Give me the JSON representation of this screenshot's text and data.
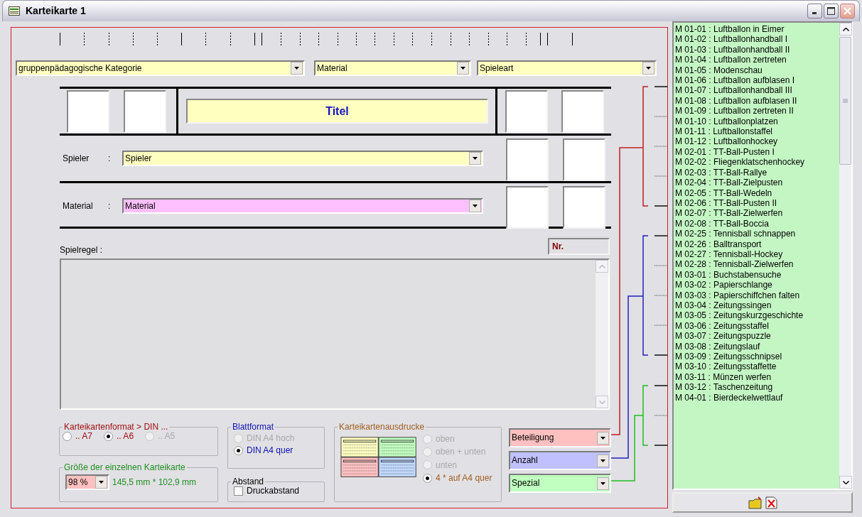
{
  "window": {
    "title": "Karteikarte 1"
  },
  "category_selects": [
    {
      "value": "gruppenpädagogische Kategorie"
    },
    {
      "value": "Material"
    },
    {
      "value": "Spieleart"
    }
  ],
  "title_field": {
    "value": "Titel"
  },
  "player_row": {
    "label": "Spieler",
    "separator": ":",
    "value": "Spieler"
  },
  "material_row": {
    "label": "Material",
    "separator": ":",
    "value": "Material"
  },
  "rules": {
    "label": "Spielregel :",
    "number_field": "Nr."
  },
  "card_format": {
    "legend": "Karteikartenformat > DIN ...",
    "options": [
      {
        "label": ".. A7",
        "selected": false,
        "disabled": false
      },
      {
        "label": ".. A6",
        "selected": true,
        "disabled": false
      },
      {
        "label": ".. A5",
        "selected": false,
        "disabled": true
      }
    ]
  },
  "card_size": {
    "legend": "Größe der einzelnen Karteikarte",
    "percent": "98 %",
    "dimensions": "145,5 mm * 102,9 mm"
  },
  "sheet_format": {
    "legend": "Blattformat",
    "options": [
      {
        "label": "DIN A4 hoch",
        "selected": false,
        "disabled": true
      },
      {
        "label": "DIN A4 quer",
        "selected": true,
        "disabled": false
      }
    ]
  },
  "spacing": {
    "legend": "Abstand",
    "checkbox": {
      "label": "Druckabstand",
      "checked": false
    }
  },
  "printouts": {
    "legend": "Karteikartenausdrucke",
    "options": [
      {
        "label": "oben",
        "selected": false,
        "disabled": true
      },
      {
        "label": "oben + unten",
        "selected": false,
        "disabled": true
      },
      {
        "label": "unten",
        "selected": false,
        "disabled": true
      },
      {
        "label": "4 * auf A4 quer",
        "selected": true,
        "disabled": false
      }
    ]
  },
  "group_selectors": [
    {
      "value": "Beteiligung",
      "color": "#ffc0c0"
    },
    {
      "value": "Anzahl",
      "color": "#c0c0ff"
    },
    {
      "value": "Spezial",
      "color": "#c0ffc0"
    }
  ],
  "game_list": {
    "items": [
      "M 01-01 : Luftballon in Eimer",
      "M 01-02 : Luftballonhandball I",
      "M 01-03 : Luftballonhandball II",
      "M 01-04 : Luftballon zertreten",
      "M 01-05 : Modenschau",
      "M 01-06 : Luftballon aufblasen I",
      "M 01-07 : Luftballonhandball III",
      "M 01-08 : Luftballon aufblasen II",
      "M 01-09 : Luftballon zertreten II",
      "M 01-10 : Luftballonplatzen",
      "M 01-11 : Luftballonstaffel",
      "M 01-12 : Luftballonhockey",
      "M 02-01 : TT-Ball-Pusten I",
      "M 02-02 : Fliegenklatschenhockey",
      "M 02-03 : TT-Ball-Rallye",
      "M 02-04 : TT-Ball-Zielpusten",
      "M 02-05 : TT-Ball-Wedeln",
      "M 02-06 : TT-Ball-Pusten II",
      "M 02-07 : TT-Ball-Zielwerfen",
      "M 02-08 : TT-Ball-Boccia",
      "M 02-25 : Tennisball schnappen",
      "M 02-26 : Balltransport",
      "M 02-27 : Tennisball-Hockey",
      "M 02-28 : Tennisball-Zielwerfen",
      "M 03-01 : Buchstabensuche",
      "M 03-02 : Papierschlange",
      "M 03-03 : Papierschiffchen falten",
      "M 03-04 : Zeitungssingen",
      "M 03-05 : Zeitungskurzgeschichte",
      "M 03-06 : Zeitungsstaffel",
      "M 03-07 : Zeitungspuzzle",
      "M 03-08 : Zeitungslauf",
      "M 03-09 : Zeitungsschnipsel",
      "M 03-10 : Zeitungsstaffette",
      "M 03-11 : Münzen werfen",
      "M 03-12 : Taschenzeitung",
      "M 04-01 : Bierdeckelwettlauf"
    ]
  }
}
